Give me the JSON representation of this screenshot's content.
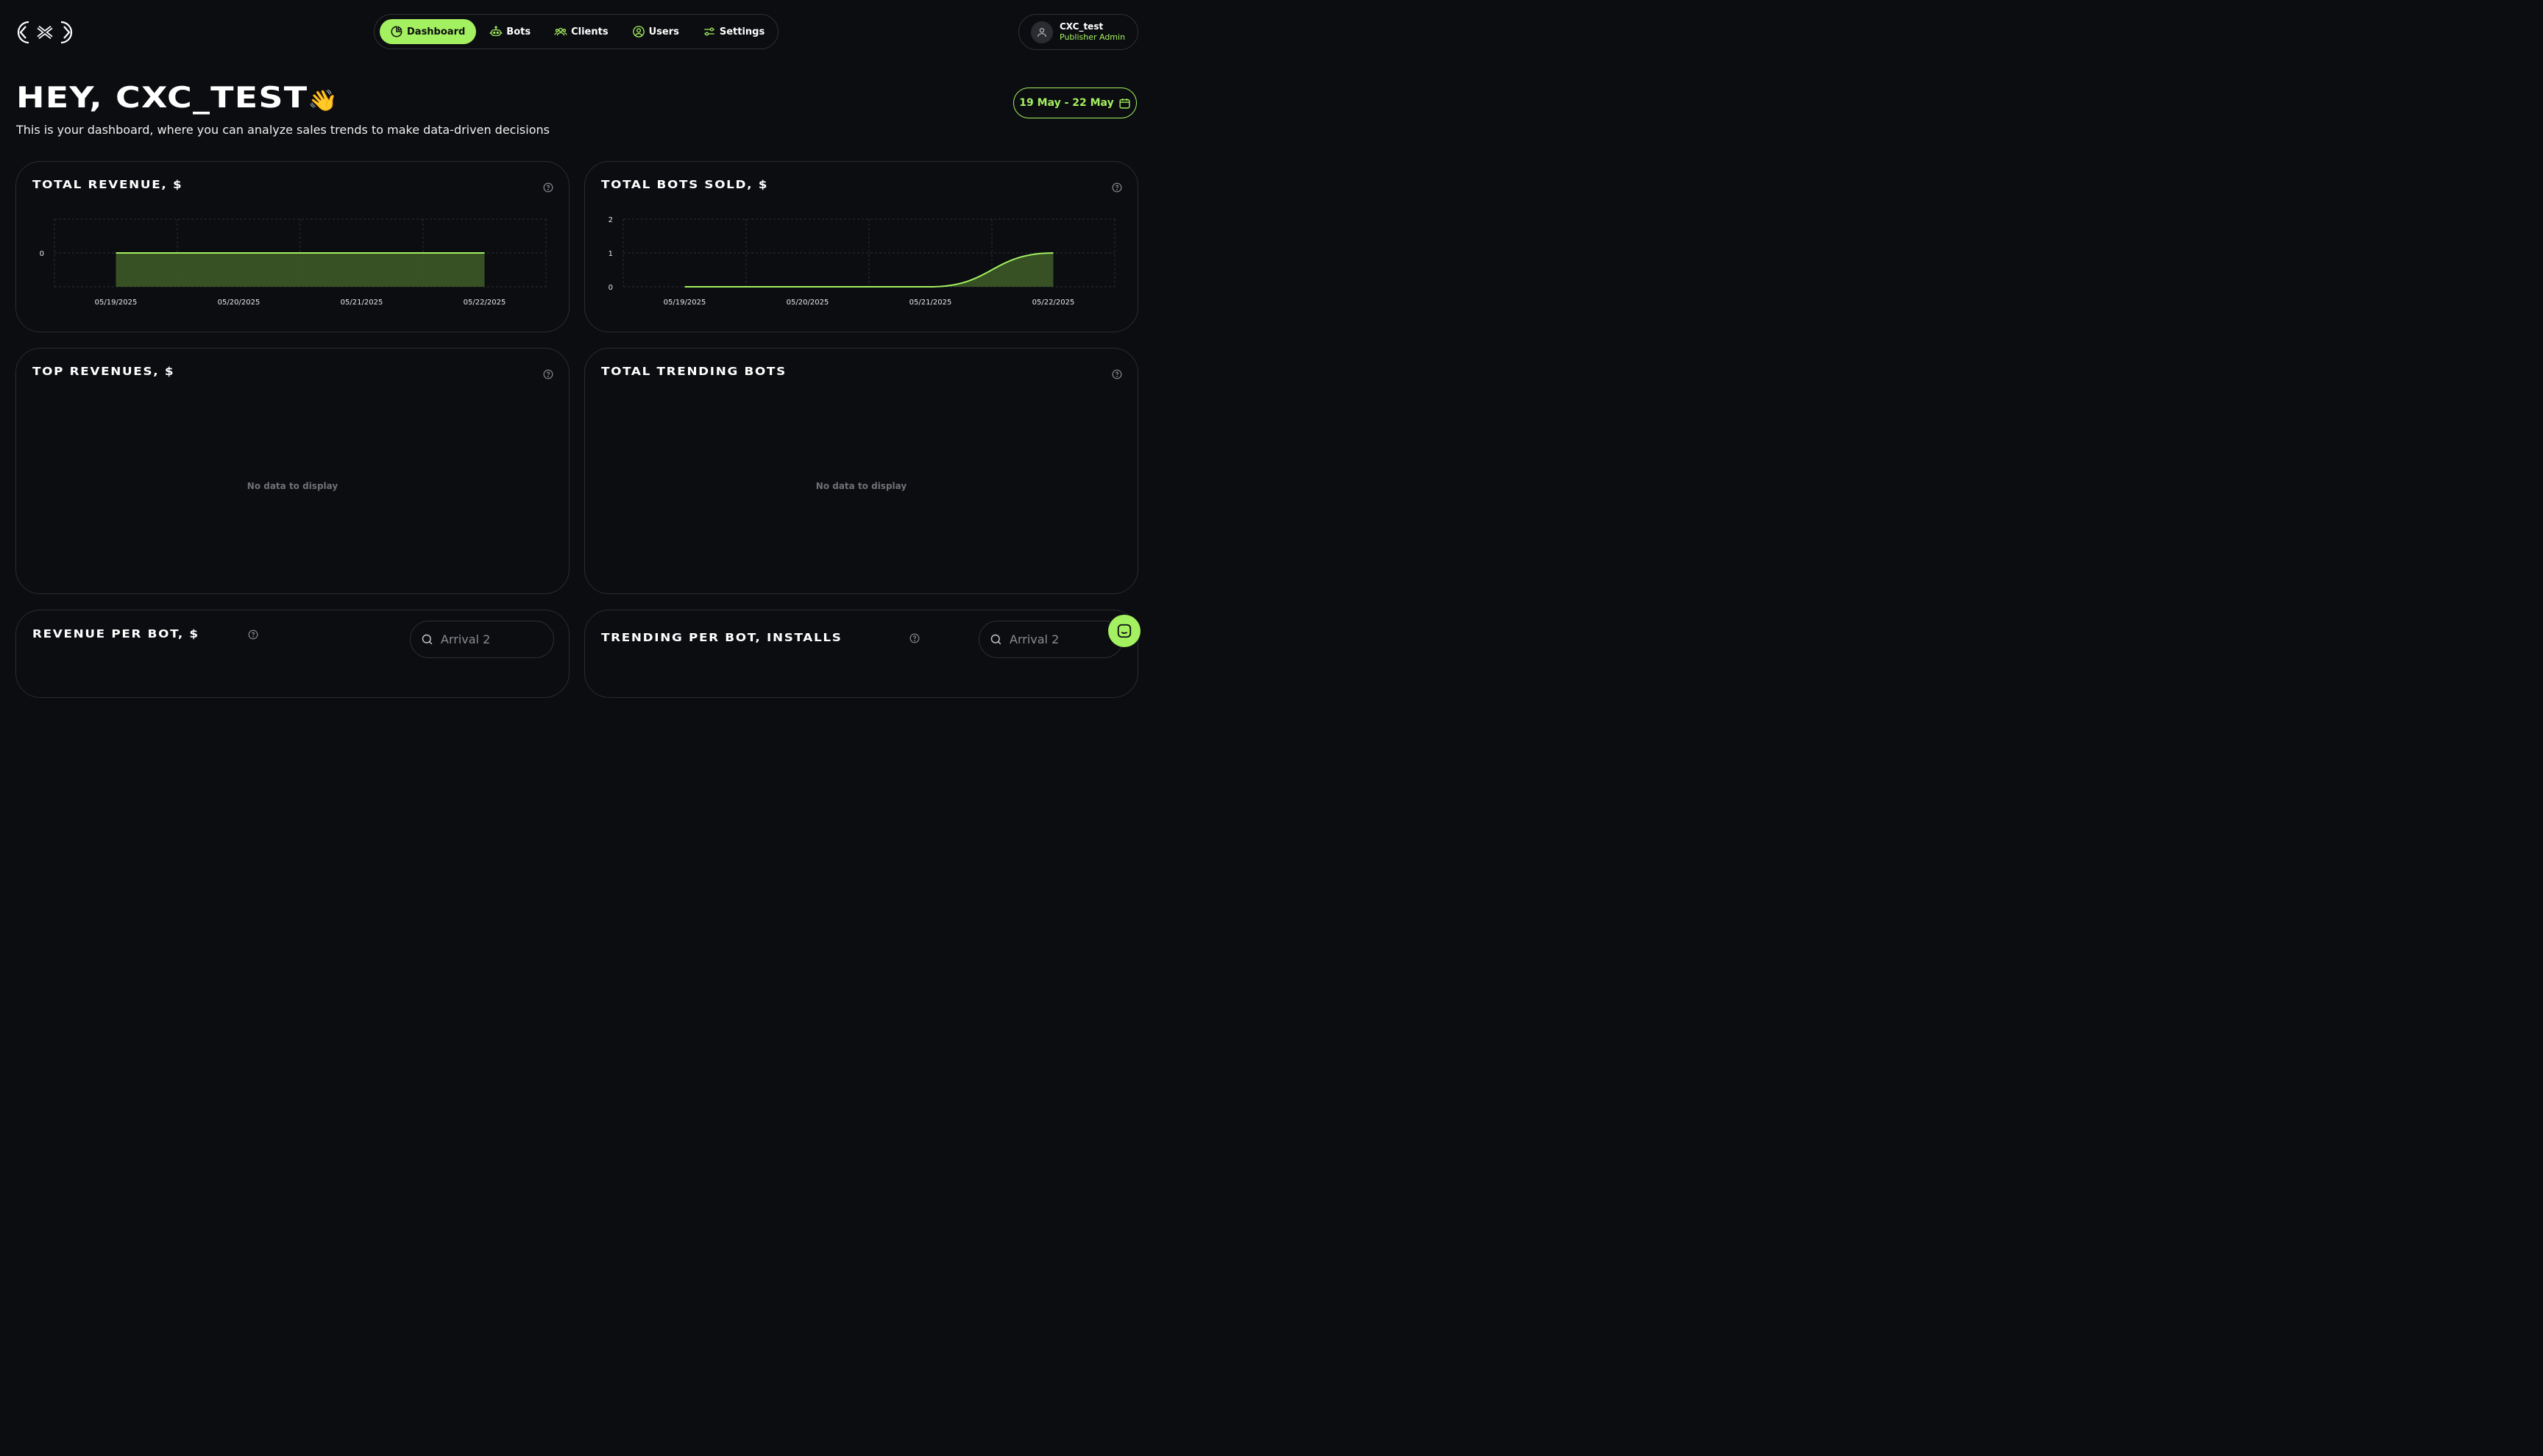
{
  "nav": {
    "items": [
      {
        "label": "Dashboard",
        "icon": "pie-chart-icon",
        "active": true
      },
      {
        "label": "Bots",
        "icon": "robot-icon"
      },
      {
        "label": "Clients",
        "icon": "clients-icon"
      },
      {
        "label": "Users",
        "icon": "user-circle-icon"
      },
      {
        "label": "Settings",
        "icon": "sliders-icon"
      }
    ]
  },
  "user": {
    "name": "CXC_test",
    "role": "Publisher Admin"
  },
  "header": {
    "title": "HEY, CXC_TEST",
    "emoji": "👋",
    "subtitle": "This is your dashboard, where you can analyze sales trends to make data-driven decisions",
    "date_range": "19 May - 22 May"
  },
  "cards": {
    "revenue": {
      "title": "TOTAL REVENUE, $"
    },
    "bots_sold": {
      "title": "TOTAL BOTS SOLD, $"
    },
    "top_revenues": {
      "title": "TOP REVENUES, $",
      "empty": "No data to display"
    },
    "trending": {
      "title": "TOTAL TRENDING BOTS",
      "empty": "No data to display"
    },
    "revenue_per_bot": {
      "title": "REVENUE PER BOT, $",
      "search_placeholder": "Arrival 2"
    },
    "trending_per_bot": {
      "title": "TRENDING PER BOT, INSTALLS",
      "search_placeholder": "Arrival 2"
    }
  },
  "colors": {
    "accent": "#a3f060",
    "background": "#0c0d10",
    "fill": "#3a5426"
  },
  "chart_data": [
    {
      "type": "area",
      "title": "TOTAL REVENUE, $",
      "x": [
        "05/19/2025",
        "05/20/2025",
        "05/21/2025",
        "05/22/2025"
      ],
      "values": [
        0,
        0,
        0,
        0
      ],
      "yticks": [
        "0"
      ],
      "grid": true
    },
    {
      "type": "area",
      "title": "TOTAL BOTS SOLD, $",
      "x": [
        "05/19/2025",
        "05/20/2025",
        "05/21/2025",
        "05/22/2025"
      ],
      "values": [
        0,
        0,
        0,
        1
      ],
      "yticks": [
        "0",
        "1",
        "2"
      ],
      "ylim": [
        0,
        2
      ],
      "grid": true
    }
  ]
}
